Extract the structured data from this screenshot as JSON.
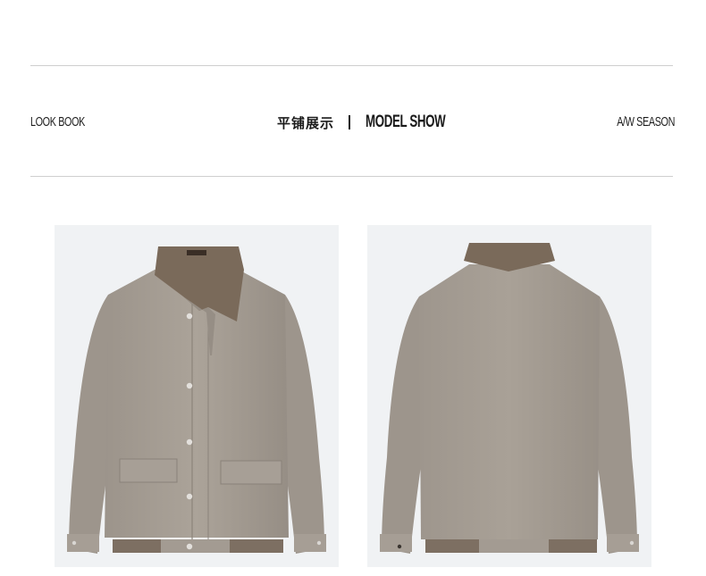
{
  "header": {
    "left_label": "LOOK BOOK",
    "center_cn": "平铺展示",
    "center_en": "MODEL SHOW",
    "right_label": "A/W SEASON"
  },
  "products": [
    {
      "view": "front",
      "image": "jacket-front-image"
    },
    {
      "view": "back",
      "image": "jacket-back-image"
    }
  ],
  "colors": {
    "background": "#ffffff",
    "rule": "#cfcfcf",
    "photo_bg": "#f0f2f4",
    "jacket": "#a39b92",
    "collar": "#7a6a5a"
  }
}
